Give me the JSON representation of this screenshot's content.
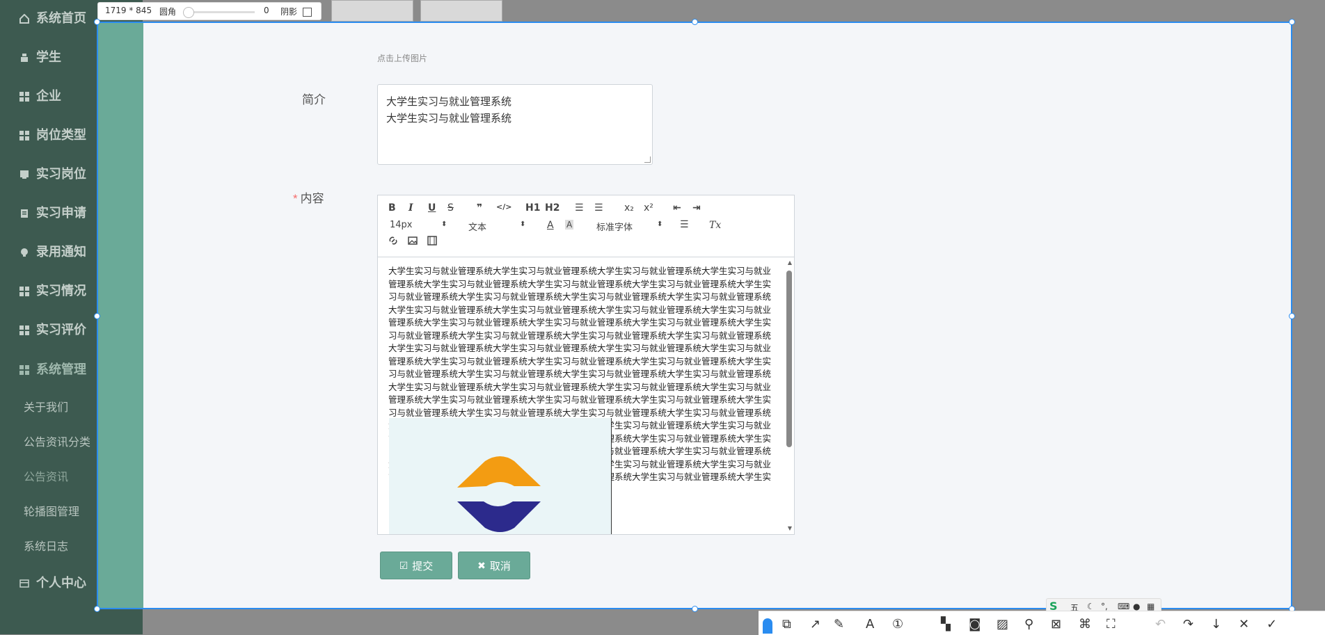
{
  "size_toolbar": {
    "dimensions": "1719 * 845",
    "radius_label": "圆角",
    "radius_value": "0",
    "radius_level": 0,
    "shadow_label": "阴影"
  },
  "sidebar": {
    "items": [
      {
        "label": "系统首页",
        "icon": "home-icon"
      },
      {
        "label": "学生",
        "icon": "person-icon"
      },
      {
        "label": "企业",
        "icon": "grid-icon"
      },
      {
        "label": "岗位类型",
        "icon": "grid-icon"
      },
      {
        "label": "实习岗位",
        "icon": "card-icon"
      },
      {
        "label": "实习申请",
        "icon": "clipboard-icon"
      },
      {
        "label": "录用通知",
        "icon": "bulb-icon"
      },
      {
        "label": "实习情况",
        "icon": "grid-icon"
      },
      {
        "label": "实习评价",
        "icon": "grid-icon"
      },
      {
        "label": "系统管理",
        "icon": "grid-icon"
      }
    ],
    "sub_items": [
      "关于我们",
      "公告资讯分类",
      "公告资讯",
      "轮播图管理",
      "系统日志"
    ],
    "personal": "个人中心"
  },
  "form": {
    "upload_hint": "点击上传图片",
    "intro_label": "简介",
    "intro_value_lines": [
      "大学生实习与就业管理系统",
      "大学生实习与就业管理系统"
    ],
    "content_label": "内容",
    "content_required_mark": "*",
    "content_text": "大学生实习与就业管理系统大学生实习与就业管理系统大学生实习与就业管理系统大学生实习与就业管理系统大学生实习与就业管理系统大学生实习与就业管理系统大学生实习与就业管理系统大学生实习与就业管理系统大学生实习与就业管理系统大学生实习与就业管理系统大学生实习与就业管理系统大学生实习与就业管理系统大学生实习与就业管理系统大学生实习与就业管理系统大学生实习与就业管理系统大学生实习与就业管理系统大学生实习与就业管理系统大学生实习与就业管理系统大学生实习与就业管理系统大学生实习与就业管理系统大学生实习与就业管理系统大学生实习与就业管理系统大学生实习与就业管理系统大学生实习与就业管理系统大学生实习与就业管理系统大学生实习与就业管理系统大学生实习与就业管理系统大学生实习与就业管理系统大学生实习与就业管理系统大学生实习与就业管理系统大学生实习与就业管理系统大学生实习与就业管理系统大学生实习与就业管理系统大学生实习与就业管理系统大学生实习与就业管理系统大学生实习与就业管理系统大学生实习与就业管理系统大学生实习与就业管理系统大学生实习与就业管理系统大学生实习与就业管理系统大学生实习与就业管理系统大学生实习与就业管理系统大学生实习与就业管理系统大学生实习与就业管理系统大学生实习与就业管理系统大学生实习与就业管理系统大学生实习与就业管理系统大学生实习与就业管理系统大学生实习与就业管理系统大学生实习与就业管理系统大学生实习与就业管理系统大学生实习与就业管理系统大学生实习与就业管理系统大学生实习与就业管理系统大学生实习与就业管理系统大学生实习与就业管理系统大学生实习与就业管理系统大学生实习与就业管理系统大学生实习与就业管理系统大学生实习与就业管理系统大学生实习与就业管理系统大学生实习与就业管理系统大学生实习与就业管理系统大学生实习与就业管理系统"
  },
  "editor_toolbar": {
    "bold": "B",
    "italic": "I",
    "underline": "U",
    "strike": "S",
    "quote": "❞",
    "code": "</>",
    "h1": "H1",
    "h2": "H2",
    "ordered_list": "☰",
    "bullet_list": "☰",
    "sub": "x₂",
    "sup": "x²",
    "outdent": "⇤",
    "indent": "⇥",
    "font_size": "14px",
    "header": "文本",
    "font_family": "标准字体",
    "clean": "Tx"
  },
  "buttons": {
    "submit": "提交",
    "cancel": "取消"
  },
  "ime": {
    "mode": "五"
  },
  "colors": {
    "accent": "#6aaa98",
    "selection": "#2a8cf0",
    "sidebar": "#3d5a50",
    "logo_orange": "#f39c12",
    "logo_blue": "#2c2a8c"
  }
}
